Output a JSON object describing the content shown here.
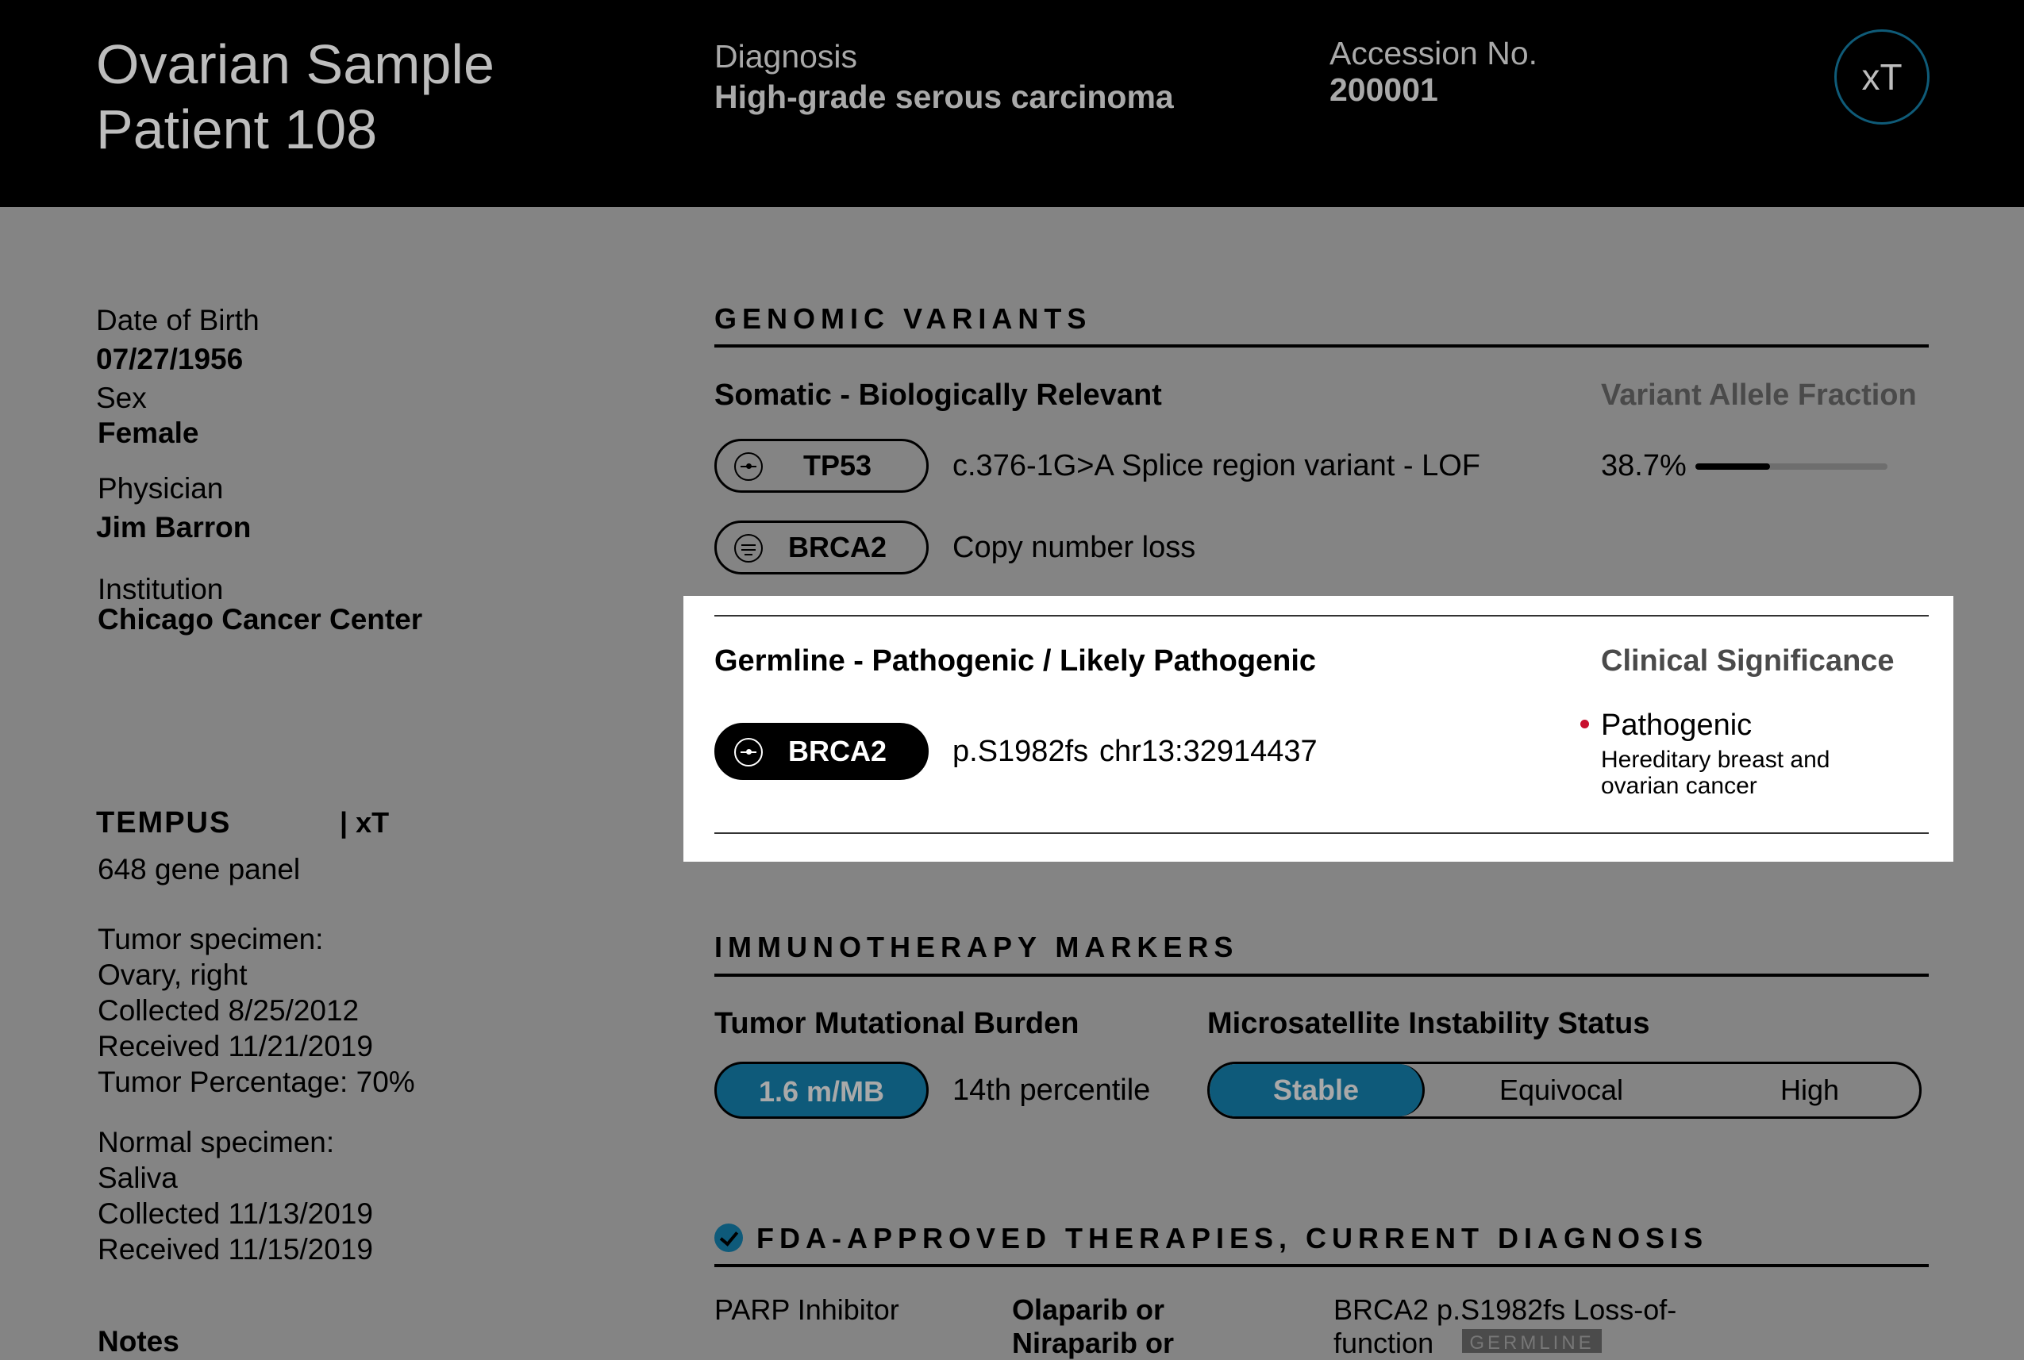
{
  "header": {
    "patient_line1": "Ovarian Sample",
    "patient_line2": "Patient 108",
    "diagnosis_label": "Diagnosis",
    "diagnosis_value": "High-grade serous carcinoma",
    "accession_label": "Accession No.",
    "accession_value": "200001",
    "logo_text": "xT"
  },
  "patient": {
    "dob_label": "Date of Birth",
    "dob_value": "07/27/1956",
    "sex_label": "Sex",
    "sex_value": "Female",
    "physician_label": "Physician",
    "physician_value": "Jim Barron",
    "institution_label": "Institution",
    "institution_value": "Chicago Cancer Center"
  },
  "test": {
    "brand": "TEMPUS",
    "product": "| xT",
    "panel": "648 gene panel",
    "tumor_label": "Tumor specimen:",
    "tumor_site": "Ovary, right",
    "tumor_collected": "Collected 8/25/2012",
    "tumor_received": "Received 11/21/2019",
    "tumor_percentage": "Tumor Percentage: 70%",
    "normal_label": "Normal specimen:",
    "normal_type": "Saliva",
    "normal_collected": "Collected 11/13/2019",
    "normal_received": "Received 11/15/2019",
    "notes_label": "Notes"
  },
  "genomic": {
    "title": "GENOMIC VARIANTS",
    "somatic_title": "Somatic - Biologically Relevant",
    "vaf_header": "Variant Allele Fraction",
    "somatic": [
      {
        "gene": "TP53",
        "change": "c.376-1G>A",
        "effect": "Splice region variant - LOF",
        "vaf": "38.7%",
        "vaf_fraction": 0.387,
        "icon": "mutation-icon"
      },
      {
        "gene": "BRCA2",
        "change": "Copy number loss",
        "icon": "copy-number-icon"
      }
    ],
    "germline_title": "Germline - Pathogenic / Likely Pathogenic",
    "clinical_header": "Clinical Significance",
    "germline": {
      "gene": "BRCA2",
      "protein": "p.S1982fs",
      "position": "chr13:32914437",
      "significance": "Pathogenic",
      "condition_line1": "Hereditary breast and",
      "condition_line2": "ovarian cancer",
      "icon": "mutation-icon"
    }
  },
  "immuno": {
    "title": "IMMUNOTHERAPY MARKERS",
    "tmb_title": "Tumor Mutational Burden",
    "tmb_value": "1.6 m/MB",
    "tmb_percentile": "14th percentile",
    "msi_title": "Microsatellite Instability Status",
    "msi_options": [
      "Stable",
      "Equivocal",
      "High"
    ],
    "msi_selected": "Stable"
  },
  "fda": {
    "title": "FDA-APPROVED THERAPIES, CURRENT DIAGNOSIS",
    "therapy_class": "PARP Inhibitor",
    "drugs_line1": "Olaparib or",
    "drugs_line2": "Niraparib or",
    "evidence_line1": "BRCA2 p.S1982fs  Loss-of-",
    "evidence_line2": "function",
    "tag": "GERMLINE"
  },
  "colors": {
    "accent": "#0e5a7a",
    "pathogenic": "#c8102e",
    "background": "#848484",
    "header": "#000000"
  }
}
